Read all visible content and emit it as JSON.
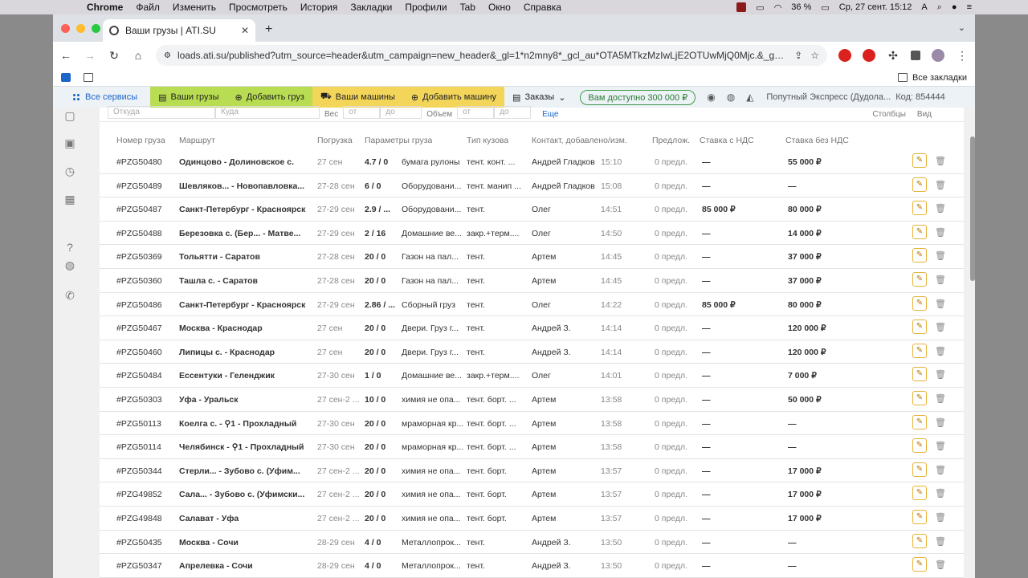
{
  "menubar": {
    "app": "Chrome",
    "items": [
      "Файл",
      "Изменить",
      "Просмотреть",
      "История",
      "Закладки",
      "Профили",
      "Tab",
      "Окно",
      "Справка"
    ],
    "battery": "36 %",
    "datetime": "Ср, 27 сент.  15:12",
    "input_lang": "A"
  },
  "browser": {
    "tab_title": "Ваши грузы | ATI.SU",
    "url": "loads.ati.su/published?utm_source=header&utm_campaign=new_header&_gl=1*n2mny8*_gcl_au*OTA5MTkzMzIwLjE2OTUwMjQ0Mjc.&_ga=2.115219...",
    "all_bookmarks": "Все закладки"
  },
  "appnav": {
    "services": "Все сервисы",
    "my_loads": "Ваши грузы",
    "add_load": "Добавить груз",
    "my_trucks": "Ваши машины",
    "add_truck": "Добавить машину",
    "orders": "Заказы",
    "promo": "Вам доступно 300 000 ₽",
    "company": "Попутный Экспресс (Дудола...",
    "code": "Код: 854444"
  },
  "filters": {
    "from_placeholder": "Откуда",
    "to_placeholder": "Куда",
    "weight": "Вес",
    "weight_from": "от",
    "weight_to": "до",
    "weight_unit": "т",
    "volume": "Объем",
    "volume_from": "от",
    "volume_to": "до",
    "volume_unit": "м³",
    "more": "Еще",
    "columns": "Столбцы",
    "view": "Вид"
  },
  "table": {
    "headers": {
      "num": "Номер груза",
      "route": "Маршрут",
      "loading": "Погрузка",
      "params": "Параметры груза",
      "body": "Тип кузова",
      "contact": "Контакт, добавлено/изм.",
      "offers": "Предлож.",
      "rate_vat": "Ставка с НДС",
      "rate_novat": "Ставка без НДС"
    },
    "rows": [
      {
        "num": "#PZG50480",
        "route": "Одинцово - Долиновское с.",
        "date": "27 сен",
        "wv": "4.7 / 0",
        "cargo": "бумага рулоны",
        "body": "тент. конт. ...",
        "contact": "Андрей Гладков",
        "time": "15:10",
        "offers": "0 предл.",
        "vat": "—",
        "novat": "55 000 ₽"
      },
      {
        "num": "#PZG50489",
        "route": "Шевляков... - Новопавловка...",
        "date": "27-28 сен",
        "wv": "6 / 0",
        "cargo": "Оборудовани...",
        "body": "тент. манип ...",
        "contact": "Андрей Гладков",
        "time": "15:08",
        "offers": "0 предл.",
        "vat": "—",
        "novat": "—"
      },
      {
        "num": "#PZG50487",
        "route": "Санкт-Петербург - Красноярск",
        "date": "27-29 сен",
        "wv": "2.9 / ...",
        "cargo": "Оборудовани...",
        "body": "тент.",
        "contact": "Олег",
        "time": "14:51",
        "offers": "0 предл.",
        "vat": "85 000 ₽",
        "novat": "80 000 ₽"
      },
      {
        "num": "#PZG50488",
        "route": "Березовка с. (Бер... - Матве...",
        "date": "27-29 сен",
        "wv": "2 / 16",
        "cargo": "Домашние ве...",
        "body": "закр.+терм....",
        "contact": "Олег",
        "time": "14:50",
        "offers": "0 предл.",
        "vat": "—",
        "novat": "14 000 ₽"
      },
      {
        "num": "#PZG50369",
        "route": "Тольятти - Саратов",
        "date": "27-28 сен",
        "wv": "20 / 0",
        "cargo": "Газон на пал...",
        "body": "тент.",
        "contact": "Артем",
        "time": "14:45",
        "offers": "0 предл.",
        "vat": "—",
        "novat": "37 000 ₽"
      },
      {
        "num": "#PZG50360",
        "route": "Ташла с. - Саратов",
        "date": "27-28 сен",
        "wv": "20 / 0",
        "cargo": "Газон на пал...",
        "body": "тент.",
        "contact": "Артем",
        "time": "14:45",
        "offers": "0 предл.",
        "vat": "—",
        "novat": "37 000 ₽"
      },
      {
        "num": "#PZG50486",
        "route": "Санкт-Петербург - Красноярск",
        "date": "27-29 сен",
        "wv": "2.86 / ...",
        "cargo": "Сборный груз",
        "body": "тент.",
        "contact": "Олег",
        "time": "14:22",
        "offers": "0 предл.",
        "vat": "85 000 ₽",
        "novat": "80 000 ₽"
      },
      {
        "num": "#PZG50467",
        "route": "Москва - Краснодар",
        "date": "27 сен",
        "wv": "20 / 0",
        "cargo": "Двери. Груз г...",
        "body": "тент.",
        "contact": "Андрей З.",
        "time": "14:14",
        "offers": "0 предл.",
        "vat": "—",
        "novat": "120 000 ₽"
      },
      {
        "num": "#PZG50460",
        "route": "Липицы с. - Краснодар",
        "date": "27 сен",
        "wv": "20 / 0",
        "cargo": "Двери. Груз г...",
        "body": "тент.",
        "contact": "Андрей З.",
        "time": "14:14",
        "offers": "0 предл.",
        "vat": "—",
        "novat": "120 000 ₽"
      },
      {
        "num": "#PZG50484",
        "route": "Ессентуки - Геленджик",
        "date": "27-30 сен",
        "wv": "1 / 0",
        "cargo": "Домашние ве...",
        "body": "закр.+терм....",
        "contact": "Олег",
        "time": "14:01",
        "offers": "0 предл.",
        "vat": "—",
        "novat": "7 000 ₽"
      },
      {
        "num": "#PZG50303",
        "route": "Уфа - Уральск",
        "date": "27 сен-2 ...",
        "wv": "10 / 0",
        "cargo": "химия не опа...",
        "body": "тент. борт. ...",
        "contact": "Артем",
        "time": "13:58",
        "offers": "0 предл.",
        "vat": "—",
        "novat": "50 000 ₽"
      },
      {
        "num": "#PZG50113",
        "route": "Коелга с. - ⚲1 - Прохладный",
        "date": "27-30 сен",
        "wv": "20 / 0",
        "cargo": "мраморная кр...",
        "body": "тент. борт. ...",
        "contact": "Артем",
        "time": "13:58",
        "offers": "0 предл.",
        "vat": "—",
        "novat": "—"
      },
      {
        "num": "#PZG50114",
        "route": "Челябинск - ⚲1 - Прохладный",
        "date": "27-30 сен",
        "wv": "20 / 0",
        "cargo": "мраморная кр...",
        "body": "тент. борт. ...",
        "contact": "Артем",
        "time": "13:58",
        "offers": "0 предл.",
        "vat": "—",
        "novat": "—"
      },
      {
        "num": "#PZG50344",
        "route": "Стерли... - Зубово с. (Уфим...",
        "date": "27 сен-2 ...",
        "wv": "20 / 0",
        "cargo": "химия не опа...",
        "body": "тент. борт.",
        "contact": "Артем",
        "time": "13:57",
        "offers": "0 предл.",
        "vat": "—",
        "novat": "17 000 ₽"
      },
      {
        "num": "#PZG49852",
        "route": "Сала... - Зубово с. (Уфимски...",
        "date": "27 сен-2 ...",
        "wv": "20 / 0",
        "cargo": "химия не опа...",
        "body": "тент. борт.",
        "contact": "Артем",
        "time": "13:57",
        "offers": "0 предл.",
        "vat": "—",
        "novat": "17 000 ₽"
      },
      {
        "num": "#PZG49848",
        "route": "Салават - Уфа",
        "date": "27 сен-2 ...",
        "wv": "20 / 0",
        "cargo": "химия не опа...",
        "body": "тент. борт.",
        "contact": "Артем",
        "time": "13:57",
        "offers": "0 предл.",
        "vat": "—",
        "novat": "17 000 ₽"
      },
      {
        "num": "#PZG50435",
        "route": "Москва - Сочи",
        "date": "28-29 сен",
        "wv": "4 / 0",
        "cargo": "Металлопрок...",
        "body": "тент.",
        "contact": "Андрей З.",
        "time": "13:50",
        "offers": "0 предл.",
        "vat": "—",
        "novat": "—"
      },
      {
        "num": "#PZG50347",
        "route": "Апрелевка - Сочи",
        "date": "28-29 сен",
        "wv": "4 / 0",
        "cargo": "Металлопрок...",
        "body": "тент.",
        "contact": "Андрей З.",
        "time": "13:50",
        "offers": "0 предл.",
        "vat": "—",
        "novat": "—"
      }
    ]
  }
}
